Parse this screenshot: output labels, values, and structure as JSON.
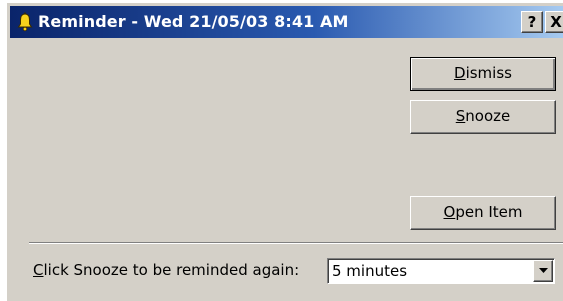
{
  "window": {
    "title": "Reminder - Wed 21/05/03 8:41 AM",
    "help_label": "?",
    "close_label": "X",
    "titlebar_colors": [
      "#0a246a",
      "#a6caf0"
    ],
    "face_color": "#d4d0c8"
  },
  "buttons": {
    "dismiss": {
      "mnemonic": "D",
      "rest": "ismiss"
    },
    "snooze": {
      "mnemonic": "S",
      "rest": "nooze"
    },
    "open_item": {
      "mnemonic": "O",
      "rest": "pen Item"
    }
  },
  "snooze_prompt": {
    "mnemonic": "C",
    "rest": "lick Snooze to be reminded again:"
  },
  "snooze_select": {
    "value": "5 minutes"
  },
  "icons": {
    "title_icon": "reminder-bell-icon",
    "dropdown": "chevron-down-icon"
  }
}
